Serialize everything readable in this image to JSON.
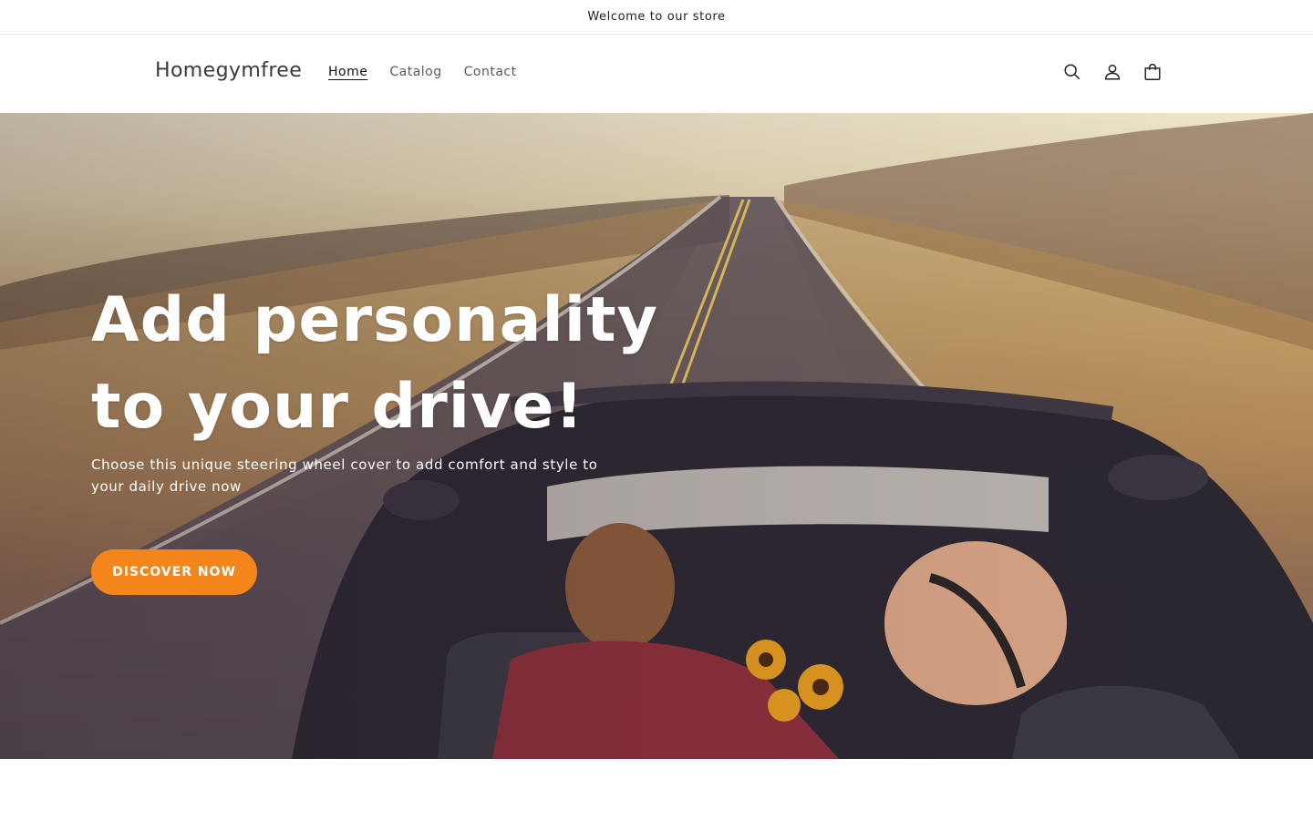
{
  "announcement": {
    "text": "Welcome to our store"
  },
  "header": {
    "brand": "Homegymfree",
    "nav": [
      {
        "label": "Home",
        "active": true
      },
      {
        "label": "Catalog",
        "active": false
      },
      {
        "label": "Contact",
        "active": false
      }
    ],
    "icons": [
      "search-icon",
      "account-icon",
      "cart-icon"
    ]
  },
  "hero": {
    "title_line1": "Add personality",
    "title_line2": "to your drive!",
    "subtitle": "Choose this unique steering wheel cover to add comfort and style to your daily drive now",
    "cta_label": "DISCOVER NOW"
  },
  "colors": {
    "cta_background": "#f4851b",
    "text_primary": "#121212",
    "text_muted": "#5a5a5a"
  }
}
